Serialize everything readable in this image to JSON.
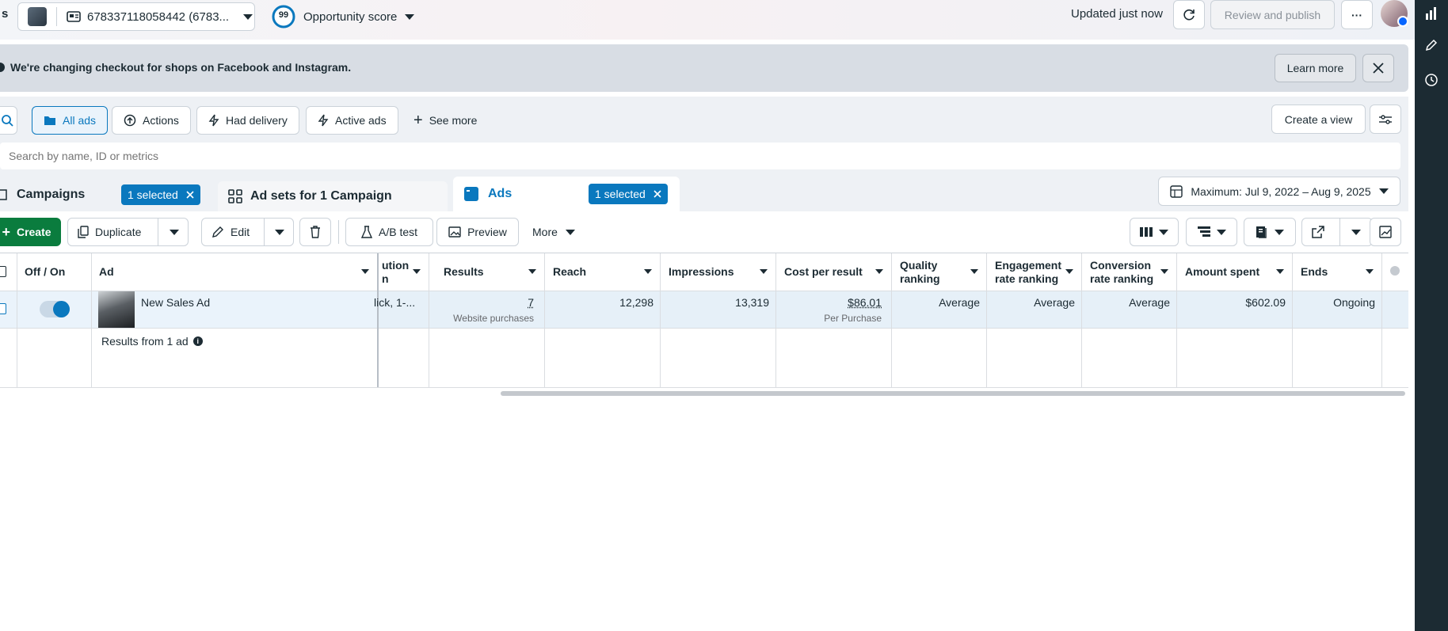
{
  "header": {
    "left_letter": "s",
    "account_id": "678337118058442 (6783...",
    "opportunity_score": "99",
    "opportunity_label": "Opportunity score",
    "updated_text": "Updated just now",
    "review_publish_label": "Review and publish",
    "more_label": "···"
  },
  "banner": {
    "text": "We're changing checkout for shops on Facebook and Instagram.",
    "learn_more": "Learn more"
  },
  "filters": {
    "all_ads": "All ads",
    "actions": "Actions",
    "had_delivery": "Had delivery",
    "active_ads": "Active ads",
    "see_more": "See more",
    "create_view": "Create a view",
    "search_placeholder": "Search by name, ID or metrics"
  },
  "tabs": {
    "campaigns": "Campaigns",
    "campaigns_selected": "1 selected",
    "adsets": "Ad sets for 1 Campaign",
    "ads": "Ads",
    "ads_selected": "1 selected",
    "date_range": "Maximum: Jul 9, 2022 – Aug 9, 2025"
  },
  "toolbar": {
    "create": "Create",
    "duplicate": "Duplicate",
    "edit": "Edit",
    "ab_test": "A/B test",
    "preview": "Preview",
    "more": "More"
  },
  "table": {
    "headers": {
      "off_on": "Off / On",
      "ad": "Ad",
      "attribution_line1": "ution",
      "attribution_line2": "n",
      "results": "Results",
      "reach": "Reach",
      "impressions": "Impressions",
      "cost_per_result": "Cost per result",
      "quality_ranking_1": "Quality",
      "quality_ranking_2": "ranking",
      "engagement_1": "Engagement",
      "engagement_2": "rate ranking",
      "conversion_1": "Conversion",
      "conversion_2": "rate ranking",
      "amount_spent": "Amount spent",
      "ends": "Ends"
    },
    "row": {
      "ad_name": "New Sales Ad",
      "attribution": "lick, 1-...",
      "results": "7",
      "results_sub": "Website purchases",
      "reach": "12,298",
      "impressions": "13,319",
      "cost_per_result": "$86.01",
      "cost_sub": "Per Purchase",
      "quality": "Average",
      "engagement": "Average",
      "conversion": "Average",
      "amount_spent": "$602.09",
      "ends": "Ongoing",
      "toggle_on": true
    },
    "summary": "Results from 1 ad"
  },
  "colors": {
    "accent": "#0a78be",
    "create_green": "#0a7c3e",
    "rail": "#1c2b33"
  }
}
